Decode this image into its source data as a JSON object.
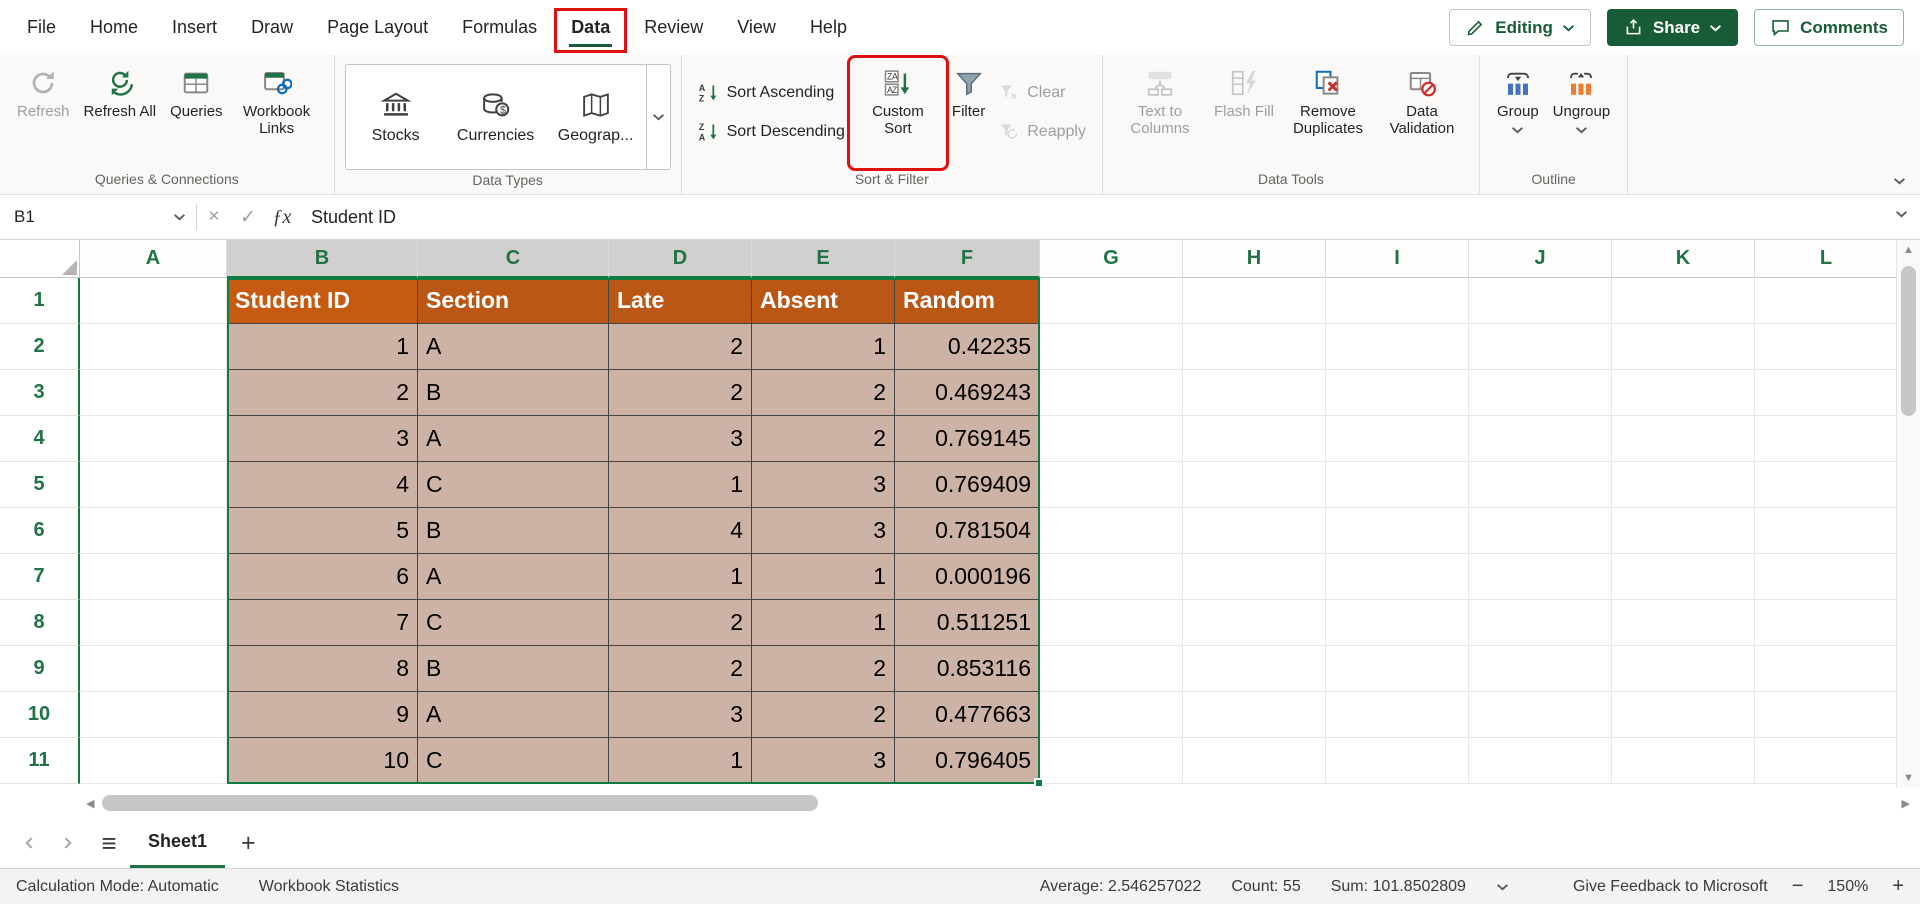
{
  "theme": {
    "excel_green": "#185C37",
    "annotation_red": "#E01010"
  },
  "menubar": {
    "items": [
      {
        "label": "File"
      },
      {
        "label": "Home"
      },
      {
        "label": "Insert"
      },
      {
        "label": "Draw"
      },
      {
        "label": "Page Layout"
      },
      {
        "label": "Formulas"
      },
      {
        "label": "Data",
        "active": true,
        "annotated": true
      },
      {
        "label": "Review"
      },
      {
        "label": "View"
      },
      {
        "label": "Help"
      }
    ],
    "editing_label": "Editing",
    "share_label": "Share",
    "comments_label": "Comments"
  },
  "ribbon": {
    "queries_group": {
      "label": "Queries & Connections",
      "refresh": "Refresh",
      "refresh_all": "Refresh All",
      "queries": "Queries",
      "workbook_links": "Workbook Links"
    },
    "data_types_group": {
      "label": "Data Types",
      "stocks": "Stocks",
      "currencies": "Currencies",
      "geography": "Geograp..."
    },
    "sort_filter_group": {
      "label": "Sort & Filter",
      "sort_ascending": "Sort Ascending",
      "sort_descending": "Sort Descending",
      "custom_sort": "Custom Sort",
      "filter": "Filter",
      "clear": "Clear",
      "reapply": "Reapply"
    },
    "data_tools_group": {
      "label": "Data Tools",
      "text_to_columns": "Text to Columns",
      "flash_fill": "Flash Fill",
      "remove_duplicates": "Remove Duplicates",
      "data_validation": "Data Validation"
    },
    "outline_group": {
      "label": "Outline",
      "group": "Group",
      "ungroup": "Ungroup"
    }
  },
  "formula_bar": {
    "name_box_value": "B1",
    "cancel_icon": "×",
    "enter_icon": "✓",
    "fx_icon": "ƒx",
    "formula_value": "Student ID"
  },
  "grid": {
    "column_letters": [
      "A",
      "B",
      "C",
      "D",
      "E",
      "F",
      "G",
      "H",
      "I",
      "J",
      "K",
      "L"
    ],
    "selected_columns": [
      "B",
      "C",
      "D",
      "E",
      "F"
    ],
    "visible_rows": 11,
    "selected_range": "B1:F11",
    "table": {
      "headers": [
        "Student ID",
        "Section",
        "Late",
        "Absent",
        "Random"
      ],
      "rows": [
        [
          1,
          "A",
          2,
          1,
          0.42235
        ],
        [
          2,
          "B",
          2,
          2,
          0.469243
        ],
        [
          3,
          "A",
          3,
          2,
          0.769145
        ],
        [
          4,
          "C",
          1,
          3,
          0.769409
        ],
        [
          5,
          "B",
          4,
          3,
          0.781504
        ],
        [
          6,
          "A",
          1,
          1,
          0.000196
        ],
        [
          7,
          "C",
          2,
          1,
          0.511251
        ],
        [
          8,
          "B",
          2,
          2,
          0.853116
        ],
        [
          9,
          "A",
          3,
          2,
          0.477663
        ],
        [
          10,
          "C",
          1,
          3,
          0.796405
        ]
      ]
    },
    "colors": {
      "table_header_bg": "#BA5715",
      "table_header_active_bg": "#C65A11",
      "table_cell_bg": "#CDB2A6",
      "selection_border": "#107C41",
      "header_text": "#217346"
    },
    "scrollbar_icons": {
      "up": "▲",
      "down": "▼",
      "left": "◀",
      "right": "▶"
    }
  },
  "sheet_bar": {
    "menu_icon": "≡",
    "sheet_name": "Sheet1",
    "add_sheet_icon": "+"
  },
  "status_bar": {
    "calculation_mode": "Calculation Mode: Automatic",
    "workbook_statistics": "Workbook Statistics",
    "average": "Average: 2.546257022",
    "count": "Count: 55",
    "sum": "Sum: 101.8502809",
    "feedback": "Give Feedback to Microsoft",
    "zoom_out_icon": "−",
    "zoom_level": "150%",
    "zoom_in_icon": "+"
  }
}
